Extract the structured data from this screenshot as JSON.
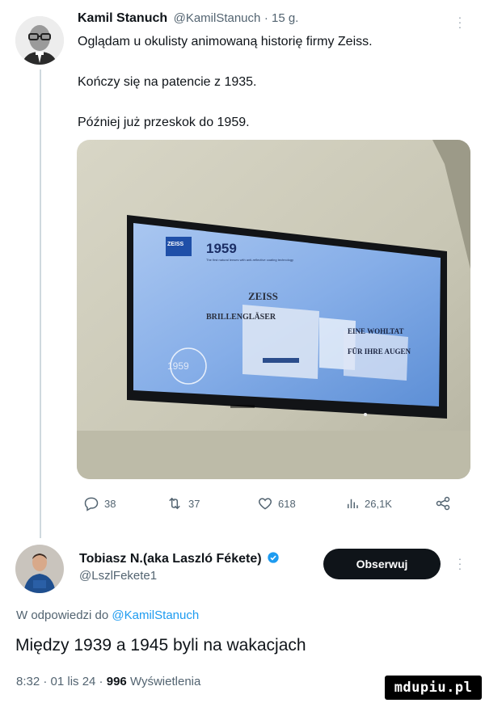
{
  "tweet": {
    "author_name": "Kamil Stanuch",
    "author_handle": "@KamilStanuch",
    "time": "· 15 g.",
    "lines": [
      "Oglądam u okulisty animowaną historię firmy Zeiss.",
      "Kończy się na patencie z 1935.",
      "Później już przeskok do 1959."
    ],
    "image": {
      "tv_logo": "ZEISS",
      "tv_year": "1959",
      "tv_subtitle": "The first natural lenses with anti-reflective coating technology",
      "tv_poster_text_1": "ZEISS",
      "tv_poster_text_2": "BRILLENGLÄSER",
      "tv_poster_text_3": "EINE WOHLTAT",
      "tv_poster_text_4": "FÜR IHRE AUGEN",
      "tv_bottom_year": "1959"
    },
    "actions": {
      "replies": "38",
      "retweets": "37",
      "likes": "618",
      "views": "26,1K"
    }
  },
  "reply": {
    "author_name": "Tobiasz N.(aka Laszló Fékete)",
    "author_handle": "@LszlFekete1",
    "follow_label": "Obserwuj",
    "reply_to_prefix": "W odpowiedzi do",
    "reply_to_handle": "@KamilStanuch",
    "text": "Między 1939 a 1945 byli na wakacjach",
    "meta_time": "8:32 · 01 lis 24 ·",
    "meta_views_count": "996",
    "meta_views_label": "Wyświetlenia"
  },
  "watermark": "mdupiu.pl",
  "colors": {
    "accent": "#1d9bf0",
    "verified": "#1d9bf0",
    "text_secondary": "#536471",
    "follow_bg": "#0f1419"
  }
}
